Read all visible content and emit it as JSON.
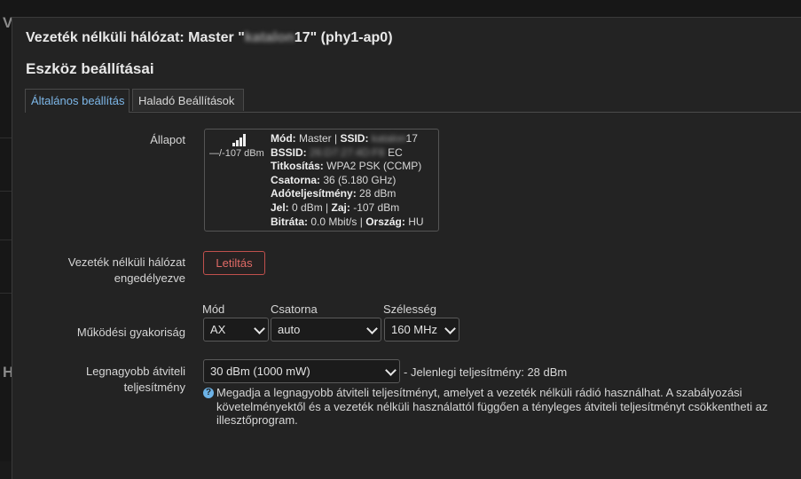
{
  "background": {
    "letter_top": "V",
    "letter_bottom": "H"
  },
  "modal": {
    "title_prefix": "Vezeték nélküli hálózat: Master \"",
    "title_ssid_masked": "katalon",
    "title_suffix": "17\" (phy1-ap0)",
    "section_title": "Eszköz beállításai"
  },
  "tabs": [
    {
      "label": "Általános beállítás",
      "active": true
    },
    {
      "label": "Haladó Beállítások",
      "active": false
    }
  ],
  "status": {
    "label": "Állapot",
    "signal_text": "—/-107 dBm",
    "mode_key": "Mód:",
    "mode_val": "Master |",
    "ssid_key": "SSID:",
    "ssid_masked": "katalon",
    "ssid_tail": "17",
    "bssid_key": "BSSID:",
    "bssid_masked": "26:D7:27:4D:F8",
    "bssid_tail": "EC",
    "enc_key": "Titkosítás:",
    "enc_val": "WPA2 PSK (CCMP)",
    "channel_key": "Csatorna:",
    "channel_val": "36 (5.180 GHz)",
    "txpower_key": "Adóteljesítmény:",
    "txpower_val": "28 dBm",
    "signal_key": "Jel:",
    "signal_val": "0 dBm |",
    "noise_key": "Zaj:",
    "noise_val": "-107 dBm",
    "bitrate_key": "Bitráta:",
    "bitrate_val": "0.0 Mbit/s |",
    "country_key": "Ország:",
    "country_val": "HU"
  },
  "enabled": {
    "label_line1": "Vezeték nélküli hálózat",
    "label_line2": "engedélyezve",
    "button": "Letiltás"
  },
  "frequency": {
    "label": "Működési gyakoriság",
    "mode_label": "Mód",
    "mode_value": "AX",
    "channel_label": "Csatorna",
    "channel_value": "auto",
    "width_label": "Szélesség",
    "width_value": "160 MHz"
  },
  "txpower": {
    "label_line1": "Legnagyobb átviteli",
    "label_line2": "teljesítmény",
    "value": "30 dBm (1000 mW)",
    "current": "- Jelenlegi teljesítmény: 28 dBm",
    "help": "Megadja a legnagyobb átviteli teljesítményt, amelyet a vezeték nélküli rádió használhat. A szabályozási követelményektől és a vezeték nélküli használattól függően a tényleges átviteli teljesítményt csökkentheti az illesztőprogram."
  },
  "colors": {
    "accent": "#7db7e8",
    "danger": "#c0504d",
    "help_icon": "#6cb2e6"
  },
  "icons": {
    "signal": "signal-strength-icon",
    "help": "question-circle-icon",
    "dropdown": "chevron-down-icon"
  }
}
